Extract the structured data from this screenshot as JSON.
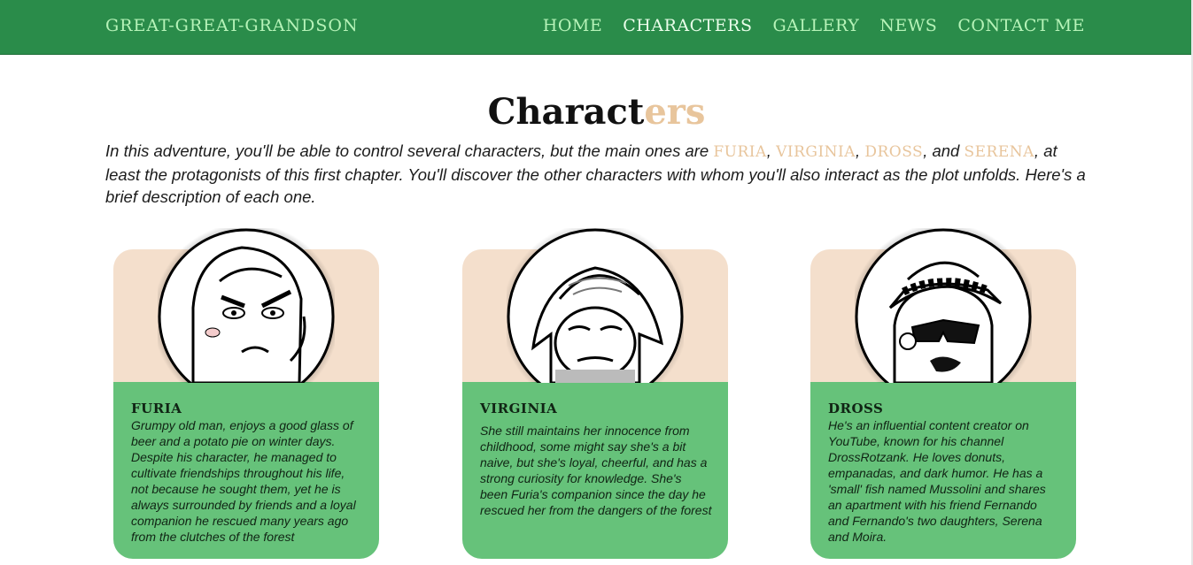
{
  "header": {
    "brand": "Great-Great-Grandson",
    "nav": [
      "Home",
      "Characters",
      "Gallery",
      "News",
      "Contact me"
    ]
  },
  "main": {
    "title_head": "Charact",
    "title_tail": "ers",
    "intro": {
      "part1": "In this adventure, you'll be able to control several characters, but the main ones are ",
      "names": [
        "Furia",
        "Virginia",
        "Dross",
        "Serena"
      ],
      "sep1": ", ",
      "sep2": ", ",
      "sep3": ", and ",
      "part2": ", at least the protagonists of this first chapter. You'll discover the other characters with whom you'll also interact as the plot unfolds. Here's a brief description of each one."
    },
    "cards": [
      {
        "name": "Furia",
        "description": "Grumpy old man, enjoys a good glass of beer and a potato pie on winter days. Despite his character, he managed to cultivate friendships throughout his life, not because he sought them, yet he is always surrounded by friends and a loyal companion he rescued many years ago from the clutches of the forest"
      },
      {
        "name": "Virginia",
        "description": "She still maintains her innocence from childhood, some might say she's a bit naive, but she's loyal, cheerful, and has a strong curiosity for knowledge. She's been Furia's companion since the day he rescued her from the dangers of the forest"
      },
      {
        "name": "Dross",
        "description": "He's an influential content creator on YouTube, known for his channel DrossRotzank. He loves donuts, empanadas, and dark humor. He has a 'small' fish named Mussolini and shares an apartment with his friend Fernando and Fernando's two daughters, Serena and Moira."
      }
    ]
  },
  "colors": {
    "nav_bg": "#2a8c4a",
    "nav_text": "#b6f3b8",
    "accent": "#e8c59c",
    "card_top": "#f4dfcc",
    "card_bottom": "#66c27a"
  }
}
